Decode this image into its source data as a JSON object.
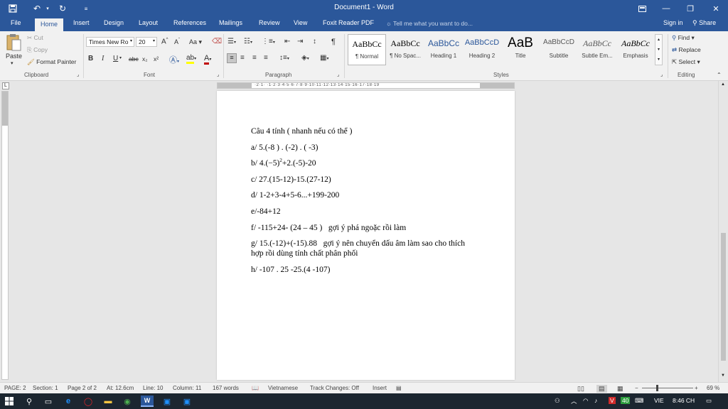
{
  "titlebar": {
    "title": "Document1 - Word",
    "save_icon": "save-icon",
    "undo_icon": "undo-icon",
    "redo_icon": "redo-icon",
    "ribbon_display_icon": "ribbon-display-icon",
    "minimize_icon": "minimize-icon",
    "restore_icon": "restore-icon",
    "close_icon": "close-icon",
    "color": "#2b579a"
  },
  "tabs": [
    {
      "label": "File"
    },
    {
      "label": "Home"
    },
    {
      "label": "Insert"
    },
    {
      "label": "Design"
    },
    {
      "label": "Layout"
    },
    {
      "label": "References"
    },
    {
      "label": "Mailings"
    },
    {
      "label": "Review"
    },
    {
      "label": "View"
    },
    {
      "label": "Foxit Reader PDF"
    }
  ],
  "tell_me": "Tell me what you want to do...",
  "sign_in": "Sign in",
  "share": "Share",
  "clipboard": {
    "paste": "Paste",
    "cut": "Cut",
    "copy": "Copy",
    "format_painter": "Format Painter",
    "label": "Clipboard"
  },
  "font": {
    "name": "Times New Ro",
    "size": "20",
    "label": "Font",
    "bold": "B",
    "italic": "I",
    "underline": "U",
    "strike": "abc",
    "subscript": "x₂",
    "superscript": "x²"
  },
  "paragraph": {
    "label": "Paragraph",
    "pilcrow": "¶"
  },
  "styles": {
    "label": "Styles",
    "items": [
      {
        "sample": "AaBbCc",
        "name": "¶ Normal"
      },
      {
        "sample": "AaBbCc",
        "name": "¶ No Spac..."
      },
      {
        "sample": "AaBbCc",
        "name": "Heading 1"
      },
      {
        "sample": "AaBbCcD",
        "name": "Heading 2"
      },
      {
        "sample": "AaB",
        "name": "Title"
      },
      {
        "sample": "AaBbCcD",
        "name": "Subtitle"
      },
      {
        "sample": "AaBbCc",
        "name": "Subtle Em..."
      },
      {
        "sample": "AaBbCc",
        "name": "Emphasis"
      }
    ]
  },
  "editing": {
    "label": "Editing",
    "find": "Find",
    "replace": "Replace",
    "select": "Select"
  },
  "ruler_numbers": "·2·1· ·1·2·3·4·5·6·7·8·9·10·11·12·13·14·15·16·17·18·19",
  "document": {
    "lines": [
      "Câu 4 tính ( nhanh nếu có thể )",
      "a/ 5.(-8 ) . (-2) . ( -3)",
      "b/ 4.(−5)",
      "c/ 27.(15-12)-15.(27-12)",
      "d/ 1-2+3-4+5-6...+199-200",
      "e/-84+12",
      "f/ -115+24- (24 – 45 )   gợi ý phá ngoặc rồi làm",
      "g/ 15.(-12)+(-15).88   gợi ý nên chuyển dấu âm làm sao cho thích hợp rồi dùng tính chất phân phối",
      "h/ -107 . 25 -25.(4 -107)"
    ],
    "b_sup": "2",
    "b_rest": "+2.(-5)-20"
  },
  "status": {
    "page": "PAGE: 2",
    "section": "Section: 1",
    "page_of": "Page 2 of 2",
    "at": "At: 12.6cm",
    "line": "Line: 10",
    "column": "Column: 11",
    "words": "167 words",
    "language": "Vietnamese",
    "track": "Track Changes: Off",
    "insert": "Insert",
    "zoom": "69 %"
  },
  "taskbar": {
    "lang": "VIE",
    "time": "8:46 CH",
    "badge": "40"
  }
}
